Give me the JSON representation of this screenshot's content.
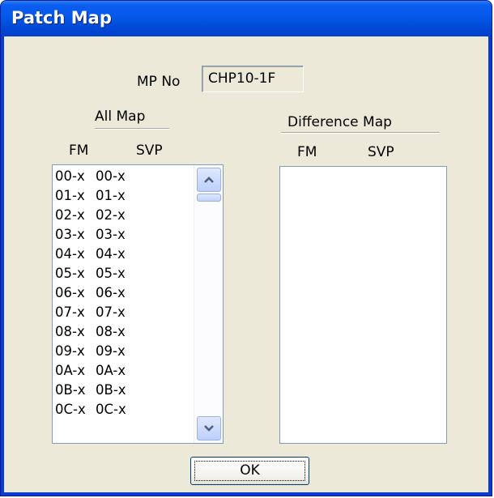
{
  "window": {
    "title": "Patch Map"
  },
  "mp_no": {
    "label": "MP No",
    "value": "CHP10-1F"
  },
  "all_map": {
    "title": "All Map",
    "headers": {
      "fm": "FM",
      "svp": "SVP"
    },
    "rows": [
      {
        "fm": "00-x",
        "svp": "00-x"
      },
      {
        "fm": "01-x",
        "svp": "01-x"
      },
      {
        "fm": "02-x",
        "svp": "02-x"
      },
      {
        "fm": "03-x",
        "svp": "03-x"
      },
      {
        "fm": "04-x",
        "svp": "04-x"
      },
      {
        "fm": "05-x",
        "svp": "05-x"
      },
      {
        "fm": "06-x",
        "svp": "06-x"
      },
      {
        "fm": "07-x",
        "svp": "07-x"
      },
      {
        "fm": "08-x",
        "svp": "08-x"
      },
      {
        "fm": "09-x",
        "svp": "09-x"
      },
      {
        "fm": "0A-x",
        "svp": "0A-x"
      },
      {
        "fm": "0B-x",
        "svp": "0B-x"
      },
      {
        "fm": "0C-x",
        "svp": "0C-x"
      }
    ]
  },
  "difference_map": {
    "title": "Difference Map",
    "headers": {
      "fm": "FM",
      "svp": "SVP"
    },
    "rows": []
  },
  "buttons": {
    "ok": "OK"
  },
  "icons": {
    "scroll_up": "chevron-up-icon",
    "scroll_down": "chevron-down-icon"
  }
}
